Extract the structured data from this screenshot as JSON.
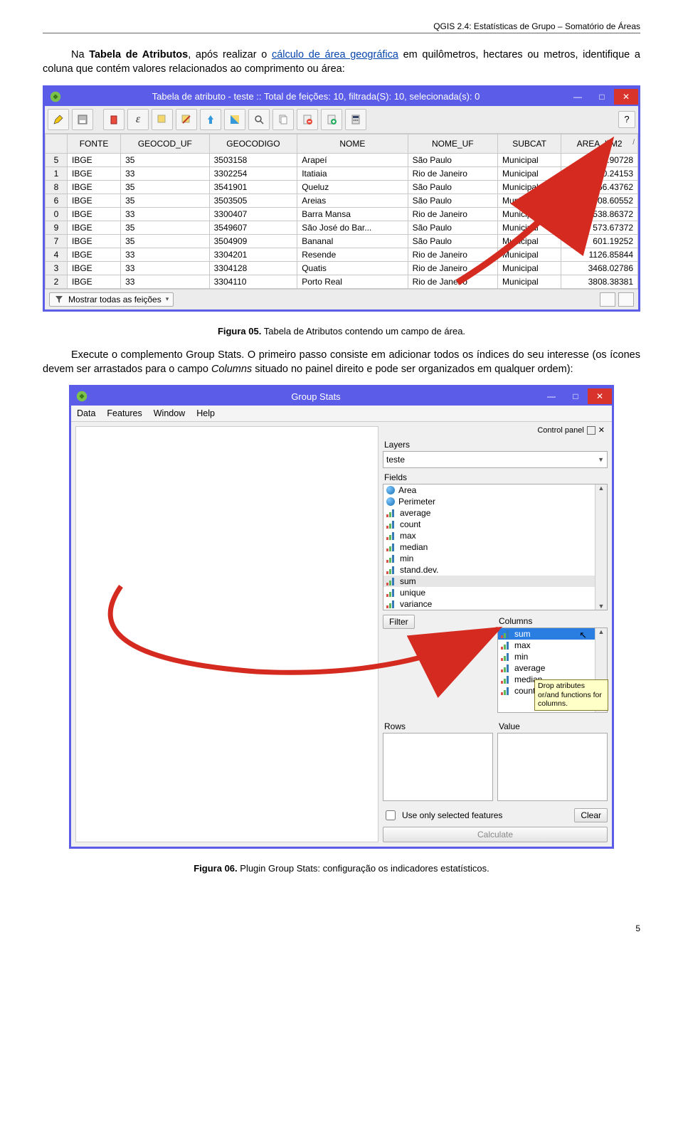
{
  "doc": {
    "header": "QGIS 2.4: Estatísticas de Grupo – Somatório de Áreas",
    "p1a": "Na ",
    "p1b": "Tabela de Atributos",
    "p1c": ", após realizar o ",
    "p1d": "cálculo de área geográfica",
    "p1e": " em quilômetros, hectares ou metros, identifique a coluna que contém valores relacionados ao comprimento ou área:",
    "fig5_bold": "Figura 05.",
    "fig5_rest": " Tabela de Atributos contendo um campo de área.",
    "p2a": "Execute o complemento Group Stats. O primeiro passo consiste em adicionar todos os índices do seu interesse (os ícones devem ser arrastados para o campo ",
    "p2b": "Columns",
    "p2c": " situado no painel direito e pode ser organizados em qualquer ordem):",
    "fig6_bold": "Figura 06.",
    "fig6_rest": " Plugin Group Stats: configuração os indicadores estatísticos.",
    "page_num": "5"
  },
  "attr_win": {
    "title": "Tabela de atributo - teste :: Total de feições: 10, filtrada(S): 10, selecionada(s): 0",
    "help": "?",
    "columns": [
      "FONTE",
      "GEOCOD_UF",
      "GEOCODIGO",
      "NOME",
      "NOME_UF",
      "SUBCAT",
      "AREA_KM2"
    ],
    "row_ids": [
      "5",
      "1",
      "8",
      "6",
      "0",
      "9",
      "7",
      "4",
      "3",
      "2"
    ],
    "rows": [
      [
        "IBGE",
        "35",
        "3503158",
        "Arapeí",
        "São Paulo",
        "Municipal",
        "153.90728"
      ],
      [
        "IBGE",
        "33",
        "3302254",
        "Itatiaia",
        "Rio de Janeiro",
        "Municipal",
        "220.24153"
      ],
      [
        "IBGE",
        "35",
        "3541901",
        "Queluz",
        "São Paulo",
        "Municipal",
        "256.43762"
      ],
      [
        "IBGE",
        "35",
        "3503505",
        "Areias",
        "São Paulo",
        "Municipal",
        "308.60552"
      ],
      [
        "IBGE",
        "33",
        "3300407",
        "Barra Mansa",
        "Rio de Janeiro",
        "Municipal",
        "538.86372"
      ],
      [
        "IBGE",
        "35",
        "3549607",
        "São José do Bar...",
        "São Paulo",
        "Municipal",
        "573.67372"
      ],
      [
        "IBGE",
        "35",
        "3504909",
        "Bananal",
        "São Paulo",
        "Municipal",
        "601.19252"
      ],
      [
        "IBGE",
        "33",
        "3304201",
        "Resende",
        "Rio de Janeiro",
        "Municipal",
        "1126.85844"
      ],
      [
        "IBGE",
        "33",
        "3304128",
        "Quatis",
        "Rio de Janeiro",
        "Municipal",
        "3468.02786"
      ],
      [
        "IBGE",
        "33",
        "3304110",
        "Porto Real",
        "Rio de Janeiro",
        "Municipal",
        "3808.38381"
      ]
    ],
    "status_label": "Mostrar todas as feições"
  },
  "gs_win": {
    "title": "Group Stats",
    "menu": [
      "Data",
      "Features",
      "Window",
      "Help"
    ],
    "control_panel": "Control panel",
    "layers_label": "Layers",
    "layer_value": "teste",
    "fields_label": "Fields",
    "fields": [
      {
        "icon": "globe",
        "name": "Area"
      },
      {
        "icon": "globe",
        "name": "Perimeter"
      },
      {
        "icon": "bars",
        "name": "average"
      },
      {
        "icon": "bars",
        "name": "count"
      },
      {
        "icon": "bars",
        "name": "max"
      },
      {
        "icon": "bars",
        "name": "median"
      },
      {
        "icon": "bars",
        "name": "min"
      },
      {
        "icon": "bars",
        "name": "stand.dev."
      },
      {
        "icon": "bars",
        "name": "sum"
      },
      {
        "icon": "bars",
        "name": "unique"
      },
      {
        "icon": "bars",
        "name": "variance"
      }
    ],
    "filter_label": "Filter",
    "columns_label": "Columns",
    "columns_items": [
      {
        "icon": "bars",
        "name": "sum",
        "hi": true
      },
      {
        "icon": "bars",
        "name": "max"
      },
      {
        "icon": "bars",
        "name": "min"
      },
      {
        "icon": "bars",
        "name": "average"
      },
      {
        "icon": "bars",
        "name": "median"
      },
      {
        "icon": "bars",
        "name": "count"
      }
    ],
    "tooltip": "Drop atributes or/and functions for columns.",
    "rows_label": "Rows",
    "value_label": "Value",
    "use_sel_label": "Use only selected features",
    "clear_label": "Clear",
    "calc_label": "Calculate"
  }
}
